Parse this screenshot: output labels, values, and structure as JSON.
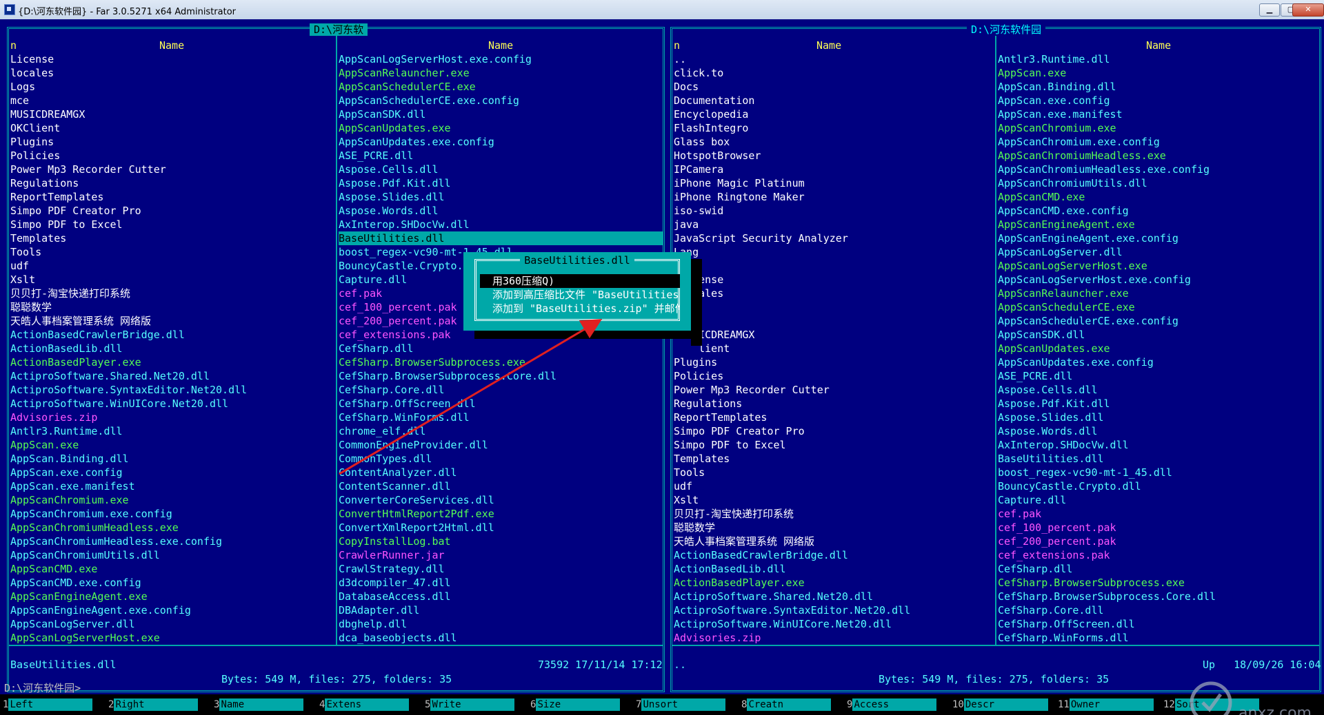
{
  "window": {
    "title": "{D:\\河东软件园} - Far 3.0.5271 x64 Administrator"
  },
  "left_panel": {
    "path": "D:\\河东软",
    "col1_header": "n",
    "col1_name_header": "Name",
    "col2_header": "Name",
    "col1": [
      {
        "name": "License",
        "color": "white"
      },
      {
        "name": "locales",
        "color": "white"
      },
      {
        "name": "Logs",
        "color": "white"
      },
      {
        "name": "mce",
        "color": "white"
      },
      {
        "name": "MUSICDREAMGX",
        "color": "white"
      },
      {
        "name": "OKClient",
        "color": "white"
      },
      {
        "name": "Plugins",
        "color": "white"
      },
      {
        "name": "Policies",
        "color": "white"
      },
      {
        "name": "Power Mp3 Recorder Cutter",
        "color": "white"
      },
      {
        "name": "Regulations",
        "color": "white"
      },
      {
        "name": "ReportTemplates",
        "color": "white"
      },
      {
        "name": "Simpo PDF Creator Pro",
        "color": "white"
      },
      {
        "name": "Simpo PDF to Excel",
        "color": "white"
      },
      {
        "name": "Templates",
        "color": "white"
      },
      {
        "name": "Tools",
        "color": "white"
      },
      {
        "name": "udf",
        "color": "white"
      },
      {
        "name": "Xslt",
        "color": "white"
      },
      {
        "name": "贝贝打-淘宝快递打印系统",
        "color": "white"
      },
      {
        "name": "聪聪数学",
        "color": "white"
      },
      {
        "name": "天皓人事档案管理系统 网络版",
        "color": "white"
      },
      {
        "name": "ActionBasedCrawlerBridge.dll",
        "color": "cyan"
      },
      {
        "name": "ActionBasedLib.dll",
        "color": "cyan"
      },
      {
        "name": "ActionBasedPlayer.exe",
        "color": "green"
      },
      {
        "name": "ActiproSoftware.Shared.Net20.dll",
        "color": "cyan"
      },
      {
        "name": "ActiproSoftware.SyntaxEditor.Net20.dll",
        "color": "cyan"
      },
      {
        "name": "ActiproSoftware.WinUICore.Net20.dll",
        "color": "cyan"
      },
      {
        "name": "Advisories.zip",
        "color": "magenta"
      },
      {
        "name": "Antlr3.Runtime.dll",
        "color": "cyan"
      },
      {
        "name": "AppScan.exe",
        "color": "green"
      },
      {
        "name": "AppScan.Binding.dll",
        "color": "cyan"
      },
      {
        "name": "AppScan.exe.config",
        "color": "cyan"
      },
      {
        "name": "AppScan.exe.manifest",
        "color": "cyan"
      },
      {
        "name": "AppScanChromium.exe",
        "color": "green"
      },
      {
        "name": "AppScanChromium.exe.config",
        "color": "cyan"
      },
      {
        "name": "AppScanChromiumHeadless.exe",
        "color": "green"
      },
      {
        "name": "AppScanChromiumHeadless.exe.config",
        "color": "cyan"
      },
      {
        "name": "AppScanChromiumUtils.dll",
        "color": "cyan"
      },
      {
        "name": "AppScanCMD.exe",
        "color": "green"
      },
      {
        "name": "AppScanCMD.exe.config",
        "color": "cyan"
      },
      {
        "name": "AppScanEngineAgent.exe",
        "color": "green"
      },
      {
        "name": "AppScanEngineAgent.exe.config",
        "color": "cyan"
      },
      {
        "name": "AppScanLogServer.dll",
        "color": "cyan"
      },
      {
        "name": "AppScanLogServerHost.exe",
        "color": "green"
      }
    ],
    "col2": [
      {
        "name": "AppScanLogServerHost.exe.config",
        "color": "cyan"
      },
      {
        "name": "AppScanRelauncher.exe",
        "color": "green"
      },
      {
        "name": "AppScanSchedulerCE.exe",
        "color": "green"
      },
      {
        "name": "AppScanSchedulerCE.exe.config",
        "color": "cyan"
      },
      {
        "name": "AppScanSDK.dll",
        "color": "cyan"
      },
      {
        "name": "AppScanUpdates.exe",
        "color": "green"
      },
      {
        "name": "AppScanUpdates.exe.config",
        "color": "cyan"
      },
      {
        "name": "ASE_PCRE.dll",
        "color": "cyan"
      },
      {
        "name": "Aspose.Cells.dll",
        "color": "cyan"
      },
      {
        "name": "Aspose.Pdf.Kit.dll",
        "color": "cyan"
      },
      {
        "name": "Aspose.Slides.dll",
        "color": "cyan"
      },
      {
        "name": "Aspose.Words.dll",
        "color": "cyan"
      },
      {
        "name": "AxInterop.SHDocVw.dll",
        "color": "cyan"
      },
      {
        "name": "BaseUtilities.dll",
        "color": "cyan",
        "selected": true
      },
      {
        "name": "boost_regex-vc90-mt-1_45.dll",
        "color": "cyan"
      },
      {
        "name": "BouncyCastle.Crypto.",
        "color": "cyan"
      },
      {
        "name": "Capture.dll",
        "color": "cyan"
      },
      {
        "name": "cef.pak",
        "color": "magenta"
      },
      {
        "name": "cef_100_percent.pak",
        "color": "magenta"
      },
      {
        "name": "cef_200_percent.pak",
        "color": "magenta"
      },
      {
        "name": "cef_extensions.pak",
        "color": "magenta"
      },
      {
        "name": "CefSharp.dll",
        "color": "cyan"
      },
      {
        "name": "CefSharp.BrowserSubprocess.exe",
        "color": "green"
      },
      {
        "name": "CefSharp.BrowserSubprocess.Core.dll",
        "color": "cyan"
      },
      {
        "name": "CefSharp.Core.dll",
        "color": "cyan"
      },
      {
        "name": "CefSharp.OffScreen.dll",
        "color": "cyan"
      },
      {
        "name": "CefSharp.WinForms.dll",
        "color": "cyan"
      },
      {
        "name": "chrome_elf.dll",
        "color": "cyan"
      },
      {
        "name": "CommonEngineProvider.dll",
        "color": "cyan"
      },
      {
        "name": "CommonTypes.dll",
        "color": "cyan"
      },
      {
        "name": "ContentAnalyzer.dll",
        "color": "cyan"
      },
      {
        "name": "ContentScanner.dll",
        "color": "cyan"
      },
      {
        "name": "ConverterCoreServices.dll",
        "color": "cyan"
      },
      {
        "name": "ConvertHtmlReport2Pdf.exe",
        "color": "green"
      },
      {
        "name": "ConvertXmlReport2Html.dll",
        "color": "cyan"
      },
      {
        "name": "CopyInstallLog.bat",
        "color": "green"
      },
      {
        "name": "CrawlerRunner.jar",
        "color": "magenta"
      },
      {
        "name": "CrawlStrategy.dll",
        "color": "cyan"
      },
      {
        "name": "d3dcompiler_47.dll",
        "color": "cyan"
      },
      {
        "name": "DatabaseAccess.dll",
        "color": "cyan"
      },
      {
        "name": "DBAdapter.dll",
        "color": "cyan"
      },
      {
        "name": "dbghelp.dll",
        "color": "cyan"
      },
      {
        "name": "dca_baseobjects.dll",
        "color": "cyan"
      }
    ],
    "status_name": "BaseUtilities.dll",
    "status_info": "73592 17/11/14 17:12",
    "summary": "Bytes: 549 M, files: 275, folders: 35"
  },
  "right_panel": {
    "path": "D:\\河东软件园",
    "col1_header": "n",
    "col1_name_header": "Name",
    "col2_header": "Name",
    "col1": [
      {
        "name": "..",
        "color": "white"
      },
      {
        "name": "click.to",
        "color": "white"
      },
      {
        "name": "Docs",
        "color": "white"
      },
      {
        "name": "Documentation",
        "color": "white"
      },
      {
        "name": "Encyclopedia",
        "color": "white"
      },
      {
        "name": "FlashIntegro",
        "color": "white"
      },
      {
        "name": "Glass box",
        "color": "white"
      },
      {
        "name": "HotspotBrowser",
        "color": "white"
      },
      {
        "name": "IPCamera",
        "color": "white"
      },
      {
        "name": "iPhone Magic Platinum",
        "color": "white"
      },
      {
        "name": "iPhone Ringtone Maker",
        "color": "white"
      },
      {
        "name": "iso-swid",
        "color": "white"
      },
      {
        "name": "java",
        "color": "white"
      },
      {
        "name": "JavaScript Security Analyzer",
        "color": "white"
      },
      {
        "name": "Lang",
        "color": "white"
      },
      {
        "name": "",
        "color": "white"
      },
      {
        "name": "    ense",
        "color": "white"
      },
      {
        "name": "    ales",
        "color": "white"
      },
      {
        "name": "",
        "color": "white"
      },
      {
        "name": "",
        "color": "white"
      },
      {
        "name": "    ICDREAMGX",
        "color": "white"
      },
      {
        "name": "    lient",
        "color": "white"
      },
      {
        "name": "Plugins",
        "color": "white"
      },
      {
        "name": "Policies",
        "color": "white"
      },
      {
        "name": "Power Mp3 Recorder Cutter",
        "color": "white"
      },
      {
        "name": "Regulations",
        "color": "white"
      },
      {
        "name": "ReportTemplates",
        "color": "white"
      },
      {
        "name": "Simpo PDF Creator Pro",
        "color": "white"
      },
      {
        "name": "Simpo PDF to Excel",
        "color": "white"
      },
      {
        "name": "Templates",
        "color": "white"
      },
      {
        "name": "Tools",
        "color": "white"
      },
      {
        "name": "udf",
        "color": "white"
      },
      {
        "name": "Xslt",
        "color": "white"
      },
      {
        "name": "贝贝打-淘宝快递打印系统",
        "color": "white"
      },
      {
        "name": "聪聪数学",
        "color": "white"
      },
      {
        "name": "天皓人事档案管理系统 网络版",
        "color": "white"
      },
      {
        "name": "ActionBasedCrawlerBridge.dll",
        "color": "cyan"
      },
      {
        "name": "ActionBasedLib.dll",
        "color": "cyan"
      },
      {
        "name": "ActionBasedPlayer.exe",
        "color": "green"
      },
      {
        "name": "ActiproSoftware.Shared.Net20.dll",
        "color": "cyan"
      },
      {
        "name": "ActiproSoftware.SyntaxEditor.Net20.dll",
        "color": "cyan"
      },
      {
        "name": "ActiproSoftware.WinUICore.Net20.dll",
        "color": "cyan"
      },
      {
        "name": "Advisories.zip",
        "color": "magenta"
      }
    ],
    "col2": [
      {
        "name": "Antlr3.Runtime.dll",
        "color": "cyan"
      },
      {
        "name": "AppScan.exe",
        "color": "green"
      },
      {
        "name": "AppScan.Binding.dll",
        "color": "cyan"
      },
      {
        "name": "AppScan.exe.config",
        "color": "cyan"
      },
      {
        "name": "AppScan.exe.manifest",
        "color": "cyan"
      },
      {
        "name": "AppScanChromium.exe",
        "color": "green"
      },
      {
        "name": "AppScanChromium.exe.config",
        "color": "cyan"
      },
      {
        "name": "AppScanChromiumHeadless.exe",
        "color": "green"
      },
      {
        "name": "AppScanChromiumHeadless.exe.config",
        "color": "cyan"
      },
      {
        "name": "AppScanChromiumUtils.dll",
        "color": "cyan"
      },
      {
        "name": "AppScanCMD.exe",
        "color": "green"
      },
      {
        "name": "AppScanCMD.exe.config",
        "color": "cyan"
      },
      {
        "name": "AppScanEngineAgent.exe",
        "color": "green"
      },
      {
        "name": "AppScanEngineAgent.exe.config",
        "color": "cyan"
      },
      {
        "name": "AppScanLogServer.dll",
        "color": "cyan"
      },
      {
        "name": "AppScanLogServerHost.exe",
        "color": "green"
      },
      {
        "name": "AppScanLogServerHost.exe.config",
        "color": "cyan"
      },
      {
        "name": "AppScanRelauncher.exe",
        "color": "green"
      },
      {
        "name": "AppScanSchedulerCE.exe",
        "color": "green"
      },
      {
        "name": "AppScanSchedulerCE.exe.config",
        "color": "cyan"
      },
      {
        "name": "AppScanSDK.dll",
        "color": "cyan"
      },
      {
        "name": "AppScanUpdates.exe",
        "color": "green"
      },
      {
        "name": "AppScanUpdates.exe.config",
        "color": "cyan"
      },
      {
        "name": "ASE_PCRE.dll",
        "color": "cyan"
      },
      {
        "name": "Aspose.Cells.dll",
        "color": "cyan"
      },
      {
        "name": "Aspose.Pdf.Kit.dll",
        "color": "cyan"
      },
      {
        "name": "Aspose.Slides.dll",
        "color": "cyan"
      },
      {
        "name": "Aspose.Words.dll",
        "color": "cyan"
      },
      {
        "name": "AxInterop.SHDocVw.dll",
        "color": "cyan"
      },
      {
        "name": "BaseUtilities.dll",
        "color": "cyan"
      },
      {
        "name": "boost_regex-vc90-mt-1_45.dll",
        "color": "cyan"
      },
      {
        "name": "BouncyCastle.Crypto.dll",
        "color": "cyan"
      },
      {
        "name": "Capture.dll",
        "color": "cyan"
      },
      {
        "name": "cef.pak",
        "color": "magenta"
      },
      {
        "name": "cef_100_percent.pak",
        "color": "magenta"
      },
      {
        "name": "cef_200_percent.pak",
        "color": "magenta"
      },
      {
        "name": "cef_extensions.pak",
        "color": "magenta"
      },
      {
        "name": "CefSharp.dll",
        "color": "cyan"
      },
      {
        "name": "CefSharp.BrowserSubprocess.exe",
        "color": "green"
      },
      {
        "name": "CefSharp.BrowserSubprocess.Core.dll",
        "color": "cyan"
      },
      {
        "name": "CefSharp.Core.dll",
        "color": "cyan"
      },
      {
        "name": "CefSharp.OffScreen.dll",
        "color": "cyan"
      },
      {
        "name": "CefSharp.WinForms.dll",
        "color": "cyan"
      }
    ],
    "status_name": "..",
    "status_info": "Up   18/09/26 16:04",
    "summary": "Bytes: 549 M, files: 275, folders: 35"
  },
  "dialog": {
    "title": "BaseUtilities.dll",
    "items": [
      {
        "label": "用360压缩Q)",
        "selected": true
      },
      {
        "label": "添加到高压缩比文件 \"BaseUtilities",
        "selected": false
      },
      {
        "label": "添加到 \"BaseUtilities.zip\" 并邮件",
        "selected": false
      }
    ]
  },
  "cmdline": "D:\\河东软件园>",
  "keybar": [
    {
      "num": "1",
      "label": "Left"
    },
    {
      "num": "2",
      "label": "Right"
    },
    {
      "num": "3",
      "label": "Name"
    },
    {
      "num": "4",
      "label": "Extens"
    },
    {
      "num": "5",
      "label": "Write"
    },
    {
      "num": "6",
      "label": "Size"
    },
    {
      "num": "7",
      "label": "Unsort"
    },
    {
      "num": "8",
      "label": "Creatn"
    },
    {
      "num": "9",
      "label": "Access"
    },
    {
      "num": "10",
      "label": "Descr"
    },
    {
      "num": "11",
      "label": "Owner"
    },
    {
      "num": "12",
      "label": "Sort"
    }
  ],
  "watermark": "anxz.com",
  "colors": {
    "panel_bg": "#000080",
    "frame": "#00a8a8",
    "header": "#ffff55",
    "dir": "#ffffff",
    "dll": "#55ffff",
    "exe": "#55ff55",
    "archive": "#ff55ff",
    "arrow": "#e02020"
  }
}
